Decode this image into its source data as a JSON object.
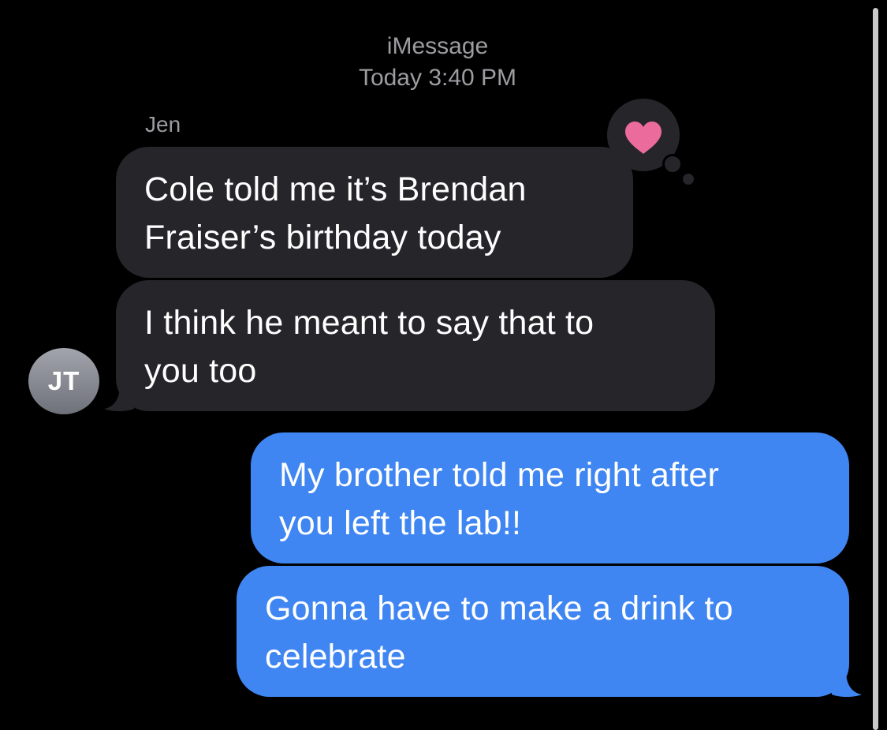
{
  "header": {
    "service": "iMessage",
    "timestamp": "Today 3:40 PM"
  },
  "conversation": {
    "sender_name": "Jen",
    "sender_avatar_initials": "JT",
    "messages": [
      {
        "direction": "incoming",
        "lines": [
          "Cole told me it’s Brendan",
          "Fraiser’s birthday today"
        ],
        "tapback": "heart-icon"
      },
      {
        "direction": "incoming",
        "lines": [
          "I think he meant to say that to",
          "you too"
        ]
      },
      {
        "direction": "outgoing",
        "lines": [
          "My brother told me right after",
          "you left the lab!!"
        ]
      },
      {
        "direction": "outgoing",
        "lines": [
          "Gonna have to make a drink to",
          "celebrate"
        ]
      }
    ]
  },
  "colors": {
    "background": "#000000",
    "incoming_bubble": "#26252a",
    "outgoing_bubble": "#3f86f2",
    "heart": "#ec6b9d",
    "meta_text": "#9c9ca1"
  }
}
